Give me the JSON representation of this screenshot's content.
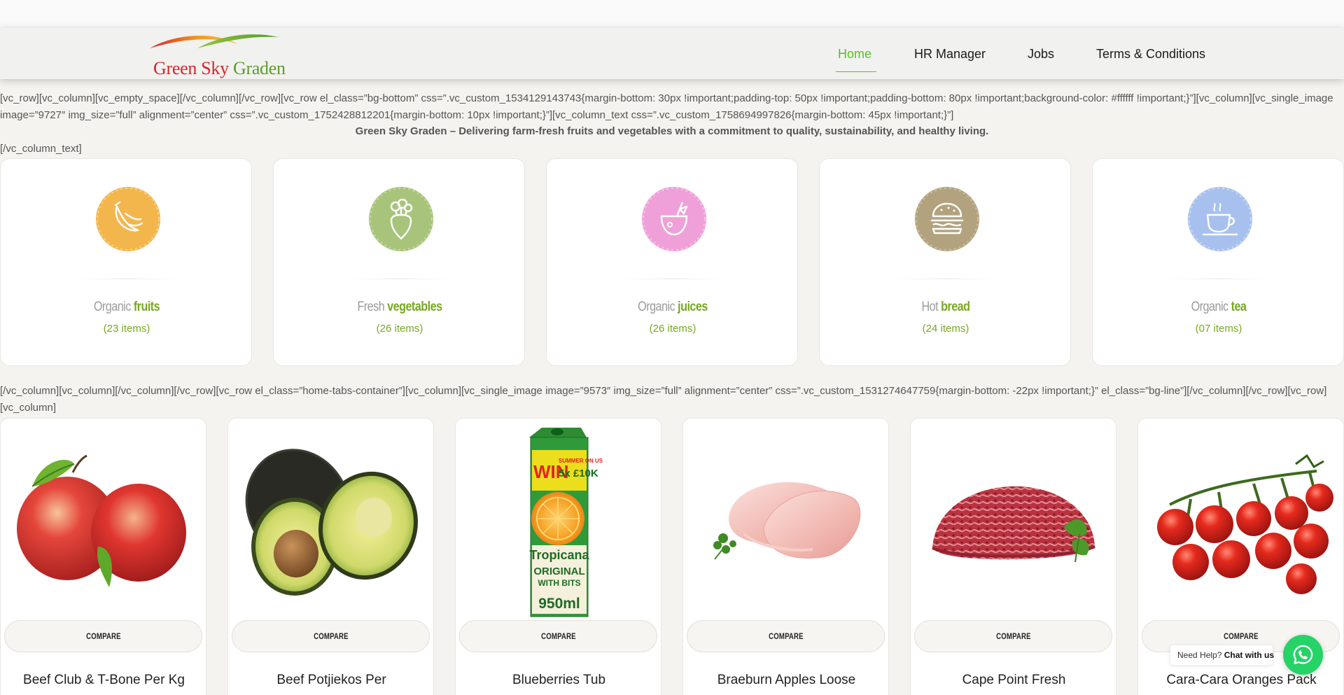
{
  "header": {
    "logo": {
      "word1": "Green Sky",
      "word2": "Graden"
    },
    "nav": [
      {
        "label": "Home",
        "active": true
      },
      {
        "label": "HR Manager",
        "active": false
      },
      {
        "label": "Jobs",
        "active": false
      },
      {
        "label": "Terms & Conditions",
        "active": false
      }
    ],
    "active_color": "#5cbd1f"
  },
  "content": {
    "shortcode_1": "[vc_row][vc_column][vc_empty_space][/vc_column][/vc_row][vc_row el_class=”bg-bottom” css=”.vc_custom_1534129143743{margin-bottom: 30px !important;padding-top: 50px !important;padding-bottom: 80px !important;background-color: #ffffff !important;}”][vc_column][vc_single_image image=”9727″ img_size=”full” alignment=”center” css=”.vc_custom_1752428812201{margin-bottom: 10px !important;}”][vc_column_text css=”.vc_custom_1758694997826{margin-bottom: 45px !important;}”]",
    "intro": "Green Sky Graden – Delivering farm-fresh fruits and vegetables with a commitment to quality, sustainability, and healthy living.",
    "shortcode_2": "[/vc_column_text]",
    "shortcode_3": "[/vc_column][vc_column][/vc_column][/vc_row][vc_row el_class=”home-tabs-container”][vc_column][vc_single_image image=”9573″ img_size=”full” alignment=”center” css=”.vc_custom_1531274647759{margin-bottom: -22px !important;}” el_class=”bg-line”][/vc_column][/vc_row][vc_row][vc_column]"
  },
  "categories": [
    {
      "light": "Organic",
      "bold": "fruits",
      "count": "(23 items)",
      "icon": "fruits-icon",
      "color": "#f3b64d"
    },
    {
      "light": "Fresh",
      "bold": "vegetables",
      "count": "(26 items)",
      "icon": "vegetables-icon",
      "color": "#a7c47a"
    },
    {
      "light": "Organic",
      "bold": "juices",
      "count": "(26 items)",
      "icon": "juices-icon",
      "color": "#f0a0d8"
    },
    {
      "light": "Hot",
      "bold": "bread",
      "count": "(24 items)",
      "icon": "bread-icon",
      "color": "#b3a27e"
    },
    {
      "light": "Organic",
      "bold": "tea",
      "count": "(07 items)",
      "icon": "tea-icon",
      "color": "#a8c0ee"
    }
  ],
  "products": [
    {
      "name": "Beef Club & T-Bone Per Kg",
      "compare": "COMPARE",
      "image": "nectarines-image"
    },
    {
      "name": "Beef Potjiekos Per",
      "compare": "COMPARE",
      "image": "avocado-image"
    },
    {
      "name": "Blueberries Tub",
      "compare": "COMPARE",
      "image": "juice-carton-image"
    },
    {
      "name": "Braeburn Apples Loose",
      "compare": "COMPARE",
      "image": "chicken-breast-image"
    },
    {
      "name": "Cape Point Fresh",
      "compare": "COMPARE",
      "image": "minced-meat-image"
    },
    {
      "name": "Cara-Cara Oranges Pack",
      "compare": "COMPARE",
      "image": "cherry-tomatoes-image"
    }
  ],
  "juice_pack": {
    "promo": "WIN",
    "promo_small": "SUMMER ON US",
    "prize": "5x £10K",
    "brand": "Tropicana",
    "line1": "ORIGINAL",
    "line2": "WITH BITS",
    "volume": "950ml"
  },
  "chat_widget": {
    "prefix": "Need Help?",
    "link": "Chat with us",
    "icon": "whatsapp-icon"
  }
}
